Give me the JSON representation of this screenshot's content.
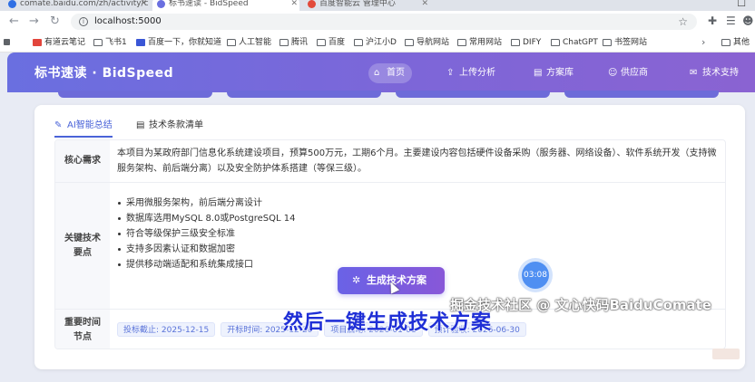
{
  "browser": {
    "tabs": [
      {
        "title": "comate.baidu.com/zh/activity/c",
        "favicon_color": "#2f6fe4"
      },
      {
        "title": "标书速读 - BidSpeed",
        "favicon_color": "#6a6fe0"
      },
      {
        "title": "百度智能云 管理中心",
        "favicon_color": "#e24a3b"
      }
    ],
    "url": "localhost:5000",
    "bookmarks": [
      {
        "label": "有道云笔记",
        "color": "#e2453c"
      },
      {
        "label": "飞书1",
        "color": "folder"
      },
      {
        "label": "百度一下，你就知道",
        "color": "#3a56d6"
      },
      {
        "label": "人工智能",
        "color": "folder"
      },
      {
        "label": "腾讯",
        "color": "folder"
      },
      {
        "label": "百度",
        "color": "folder"
      },
      {
        "label": "沪江小D",
        "color": "folder"
      },
      {
        "label": "导航网站",
        "color": "folder"
      },
      {
        "label": "常用网站",
        "color": "folder"
      },
      {
        "label": "DIFY",
        "color": "folder"
      },
      {
        "label": "ChatGPT",
        "color": "folder"
      },
      {
        "label": "书签网站",
        "color": "folder"
      },
      {
        "label": "其他",
        "color": "folder"
      }
    ]
  },
  "app": {
    "brand": "标书速读 · BidSpeed",
    "nav": [
      {
        "label": "首页",
        "icon": "home-icon",
        "glyph": "⌂",
        "active": true
      },
      {
        "label": "上传分析",
        "icon": "upload-icon",
        "glyph": "⇪",
        "active": false
      },
      {
        "label": "方案库",
        "icon": "document-icon",
        "glyph": "▤",
        "active": false
      },
      {
        "label": "供应商",
        "icon": "users-icon",
        "glyph": "☺",
        "active": false
      },
      {
        "label": "技术支持",
        "icon": "chat-icon",
        "glyph": "✉",
        "active": false
      }
    ],
    "tabs": [
      {
        "label": "AI智能总结",
        "icon": "ai-icon",
        "glyph": "✎",
        "active": true
      },
      {
        "label": "技术条款清单",
        "icon": "list-icon",
        "glyph": "▤",
        "active": false
      }
    ],
    "summary": {
      "core_label": "核心需求",
      "core_text": "本项目为某政府部门信息化系统建设项目，预算500万元，工期6个月。主要建设内容包括硬件设备采购（服务器、网络设备）、软件系统开发（支持微服务架构、前后端分离）以及安全防护体系搭建（等保三级）。",
      "tech_label": "关键技术要点",
      "tech_points": [
        "采用微服务架构，前后端分离设计",
        "数据库选用MySQL 8.0或PostgreSQL 14",
        "符合等级保护三级安全标准",
        "支持多因素认证和数据加密",
        "提供移动端适配和系统集成接口"
      ],
      "time_label": "重要时间节点",
      "milestones": [
        "投标截止: 2025-12-15",
        "开标时间: 2025-12-20",
        "项目启动: 2026-01-01",
        "预计验收: 2026-06-30"
      ]
    },
    "generate_button": "生成技术方案",
    "timer": "03:08"
  },
  "overlay": {
    "watermark": "掘金技术社区 @ 文心快码BaiduComate",
    "caption": "然后一键生成技术方案"
  }
}
